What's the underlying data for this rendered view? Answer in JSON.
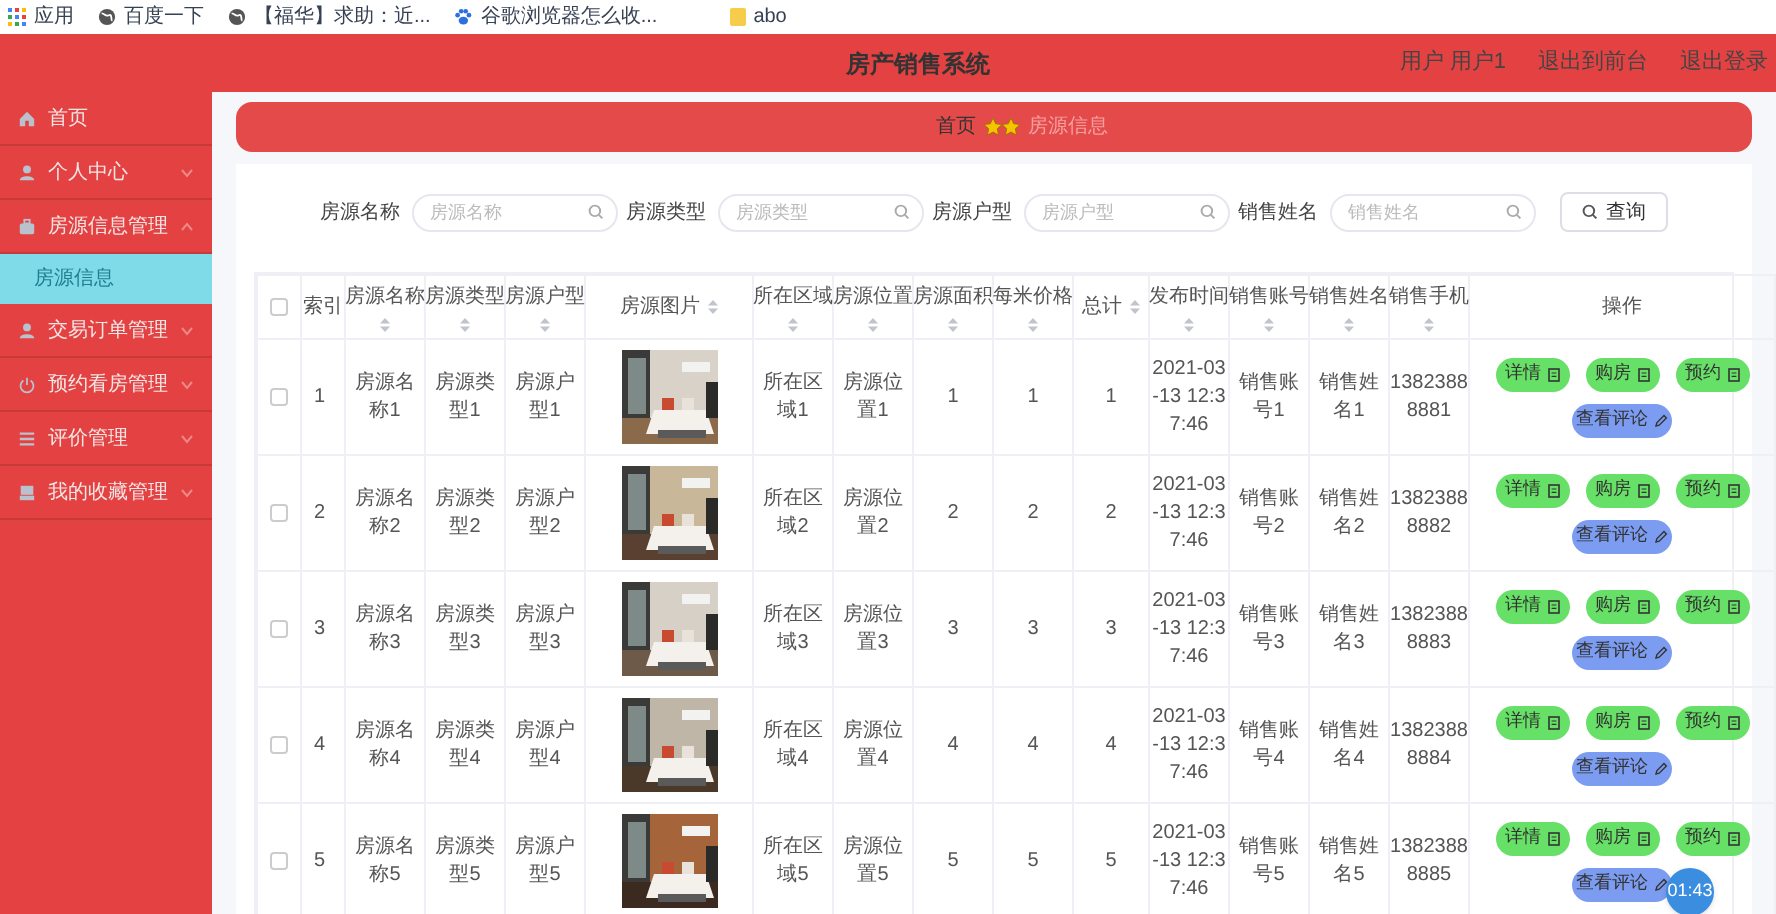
{
  "bookmarks": [
    "应用",
    "百度一下",
    "【福华】求助：近...",
    "谷歌浏览器怎么收...",
    "abo"
  ],
  "header": {
    "title": "房产销售系统",
    "links": [
      "用户 用户1",
      "退出到前台",
      "退出登录"
    ]
  },
  "sidebar": {
    "items": [
      {
        "label": "首页"
      },
      {
        "label": "个人中心",
        "expanded": false
      },
      {
        "label": "房源信息管理",
        "expanded": true,
        "children": [
          {
            "label": "房源信息",
            "selected": true
          }
        ]
      },
      {
        "label": "交易订单管理",
        "expanded": false
      },
      {
        "label": "预约看房管理",
        "expanded": false
      },
      {
        "label": "评价管理",
        "expanded": false
      },
      {
        "label": "我的收藏管理",
        "expanded": false
      }
    ]
  },
  "breadcrumb": {
    "home": "首页",
    "current": "房源信息"
  },
  "search": {
    "fields": [
      {
        "label": "房源名称",
        "placeholder": "房源名称"
      },
      {
        "label": "房源类型",
        "placeholder": "房源类型"
      },
      {
        "label": "房源户型",
        "placeholder": "房源户型"
      },
      {
        "label": "销售姓名",
        "placeholder": "销售姓名"
      }
    ],
    "button": "查询"
  },
  "table": {
    "columns": [
      {
        "label": "索引",
        "sortable": false
      },
      {
        "label": "房源名称",
        "sortable": true
      },
      {
        "label": "房源类型",
        "sortable": true
      },
      {
        "label": "房源户型",
        "sortable": true
      },
      {
        "label": "房源图片",
        "sortable": true
      },
      {
        "label": "所在区域",
        "sortable": true
      },
      {
        "label": "房源位置",
        "sortable": true
      },
      {
        "label": "房源面积",
        "sortable": true
      },
      {
        "label": "每米价格",
        "sortable": true
      },
      {
        "label": "总计",
        "sortable": true
      },
      {
        "label": "发布时间",
        "sortable": true
      },
      {
        "label": "销售账号",
        "sortable": true
      },
      {
        "label": "销售姓名",
        "sortable": true
      },
      {
        "label": "销售手机",
        "sortable": true
      },
      {
        "label": "操作",
        "sortable": false
      }
    ],
    "rows": [
      {
        "checked": false,
        "cells": [
          "1",
          "房源名称1",
          "房源类型1",
          "房源户型1",
          null,
          "所在区域1",
          "房源位置1",
          "1",
          "1",
          "1",
          "2021-03-13 12:37:46",
          "销售账号1",
          "销售姓名1",
          "13823888881"
        ],
        "actions": [
          {
            "label": "详情",
            "kind": "primary"
          },
          {
            "label": "购房",
            "kind": "primary"
          },
          {
            "label": "预约",
            "kind": "primary"
          },
          {
            "label": "查看评论",
            "kind": "secondary"
          }
        ]
      },
      {
        "checked": false,
        "cells": [
          "2",
          "房源名称2",
          "房源类型2",
          "房源户型2",
          null,
          "所在区域2",
          "房源位置2",
          "2",
          "2",
          "2",
          "2021-03-13 12:37:46",
          "销售账号2",
          "销售姓名2",
          "13823888882"
        ],
        "actions": [
          {
            "label": "详情",
            "kind": "primary"
          },
          {
            "label": "购房",
            "kind": "primary"
          },
          {
            "label": "预约",
            "kind": "primary"
          },
          {
            "label": "查看评论",
            "kind": "secondary"
          }
        ]
      },
      {
        "checked": false,
        "cells": [
          "3",
          "房源名称3",
          "房源类型3",
          "房源户型3",
          null,
          "所在区域3",
          "房源位置3",
          "3",
          "3",
          "3",
          "2021-03-13 12:37:46",
          "销售账号3",
          "销售姓名3",
          "13823888883"
        ],
        "actions": [
          {
            "label": "详情",
            "kind": "primary"
          },
          {
            "label": "购房",
            "kind": "primary"
          },
          {
            "label": "预约",
            "kind": "primary"
          },
          {
            "label": "查看评论",
            "kind": "secondary"
          }
        ]
      },
      {
        "checked": false,
        "cells": [
          "4",
          "房源名称4",
          "房源类型4",
          "房源户型4",
          null,
          "所在区域4",
          "房源位置4",
          "4",
          "4",
          "4",
          "2021-03-13 12:37:46",
          "销售账号4",
          "销售姓名4",
          "13823888884"
        ],
        "actions": [
          {
            "label": "详情",
            "kind": "primary"
          },
          {
            "label": "购房",
            "kind": "primary"
          },
          {
            "label": "预约",
            "kind": "primary"
          },
          {
            "label": "查看评论",
            "kind": "secondary"
          }
        ]
      },
      {
        "checked": false,
        "cells": [
          "5",
          "房源名称5",
          "房源类型5",
          "房源户型5",
          null,
          "所在区域5",
          "房源位置5",
          "5",
          "5",
          "5",
          "2021-03-13 12:37:46",
          "销售账号5",
          "销售姓名5",
          "13823888885"
        ],
        "actions": [
          {
            "label": "详情",
            "kind": "primary"
          },
          {
            "label": "购房",
            "kind": "primary"
          },
          {
            "label": "预约",
            "kind": "primary"
          },
          {
            "label": "查看评论",
            "kind": "secondary"
          }
        ]
      }
    ],
    "select_all": {
      "checked": false
    }
  },
  "timer": "01:43"
}
